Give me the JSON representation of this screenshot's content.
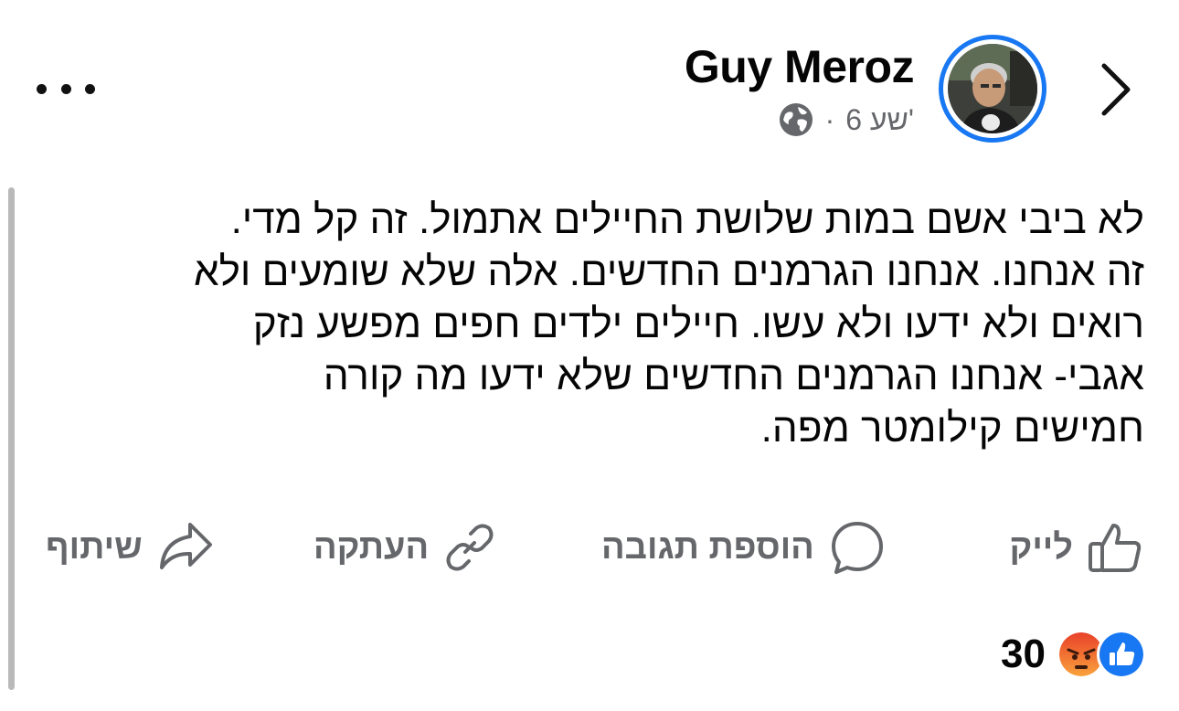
{
  "post": {
    "author": "Guy Meroz",
    "time": "6 שע'",
    "separator": "·",
    "privacy_icon": "globe-icon",
    "text_lines": [
      "לא ביבי אשם במות שלושת החיילים אתמול. זה קל מדי.",
      "זה אנחנו. אנחנו הגרמנים החדשים. אלה שלא שומעים ולא",
      "רואים ולא ידעו ולא עשו. חיילים ילדים חפים מפשע נזק",
      "אגבי- אנחנו הגרמנים החדשים שלא ידעו מה קורה",
      "חמישים קילומטר מפה."
    ]
  },
  "actions": {
    "like": "לייק",
    "comment": "הוספת תגובה",
    "copy": "העתקה",
    "share": "שיתוף"
  },
  "reactions": {
    "count": "30",
    "types": [
      "like-reaction-icon",
      "angry-reaction-icon"
    ]
  },
  "colors": {
    "accent": "#1877f2",
    "secondary_text": "#65676b",
    "angry": "#f0592a"
  }
}
